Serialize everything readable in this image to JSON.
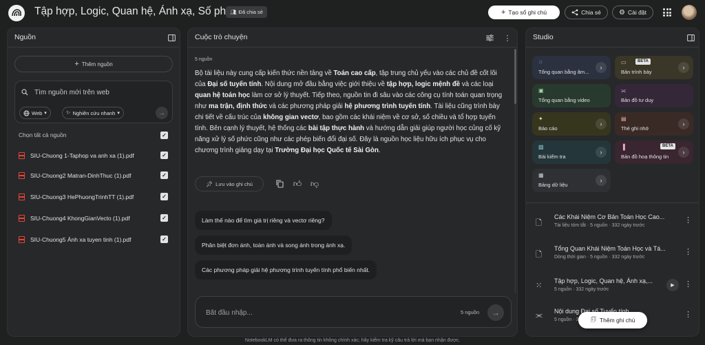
{
  "header": {
    "title": "Tập hợp, Logic, Quan hệ, Ánh xạ, Số phức",
    "shared_badge": "Đã chia sẻ",
    "create_button": "Tạo sổ ghi chú",
    "share_button": "Chia sẻ",
    "settings_button": "Cài đặt"
  },
  "sources": {
    "title": "Nguồn",
    "add_button": "Thêm nguồn",
    "search_placeholder": "Tìm nguồn mới trên web",
    "web_chip": "Web",
    "research_chip": "Nghiên cứu nhanh",
    "select_all": "Chọn tất cả nguồn",
    "items": [
      {
        "label": "SIU-Chuong 1-Taphop va anh xa (1).pdf"
      },
      {
        "label": "SIU-Chuong2 Matran-DinhThuc (1).pdf"
      },
      {
        "label": "SIU-Chuong3 HePhuongTrinhTT (1).pdf"
      },
      {
        "label": "SIU-Chuong4 KhongGianVecto (1).pdf"
      },
      {
        "label": "SIU-Chuong5 Ánh xa tuyen tinh (1).pdf"
      }
    ]
  },
  "chat": {
    "title": "Cuộc trò chuyện",
    "source_count": "5 nguồn",
    "summary": {
      "p1": "Bộ tài liệu này cung cấp kiến thức nền tảng về ",
      "b1": "Toán cao cấp",
      "p2": ", tập trung chủ yếu vào các chủ đề cốt lõi của ",
      "b2": "Đại số tuyến tính",
      "p3": ". Nội dung mở đầu bằng việc giới thiệu về ",
      "b3": "tập hợp, logic mệnh đề",
      "p4": " và các loại ",
      "b4": "quan hệ toán học",
      "p5": " làm cơ sở lý thuyết. Tiếp theo, nguồn tin đi sâu vào các công cụ tính toán quan trọng như ",
      "b5": "ma trận, định thức",
      "p6": " và các phương pháp giải ",
      "b6": "hệ phương trình tuyến tính",
      "p7": ". Tài liệu cũng trình bày chi tiết về cấu trúc của ",
      "b7": "không gian vectơ",
      "p8": ", bao gồm các khái niệm về cơ sở, số chiều và tổ hợp tuyến tính. Bên cạnh lý thuyết, hệ thống các ",
      "b8": "bài tập thực hành",
      "p9": " và hướng dẫn giải giúp người học củng cố kỹ năng xử lý số phức cũng như các phép biến đổi đại số. Đây là nguồn học liệu hữu ích phục vụ cho chương trình giảng dạy tại ",
      "b9": "Trường Đại học Quốc tế Sài Gòn",
      "p10": "."
    },
    "save_note": "Lưu vào ghi chú",
    "suggestions": [
      "Làm thế nào để tìm giá trị riêng và vectơ riêng?",
      "Phân biệt đơn ánh, toàn ánh và song ánh trong ánh xạ.",
      "Các phương pháp giải hệ phương trình tuyến tính phổ biến nhất."
    ],
    "input_placeholder": "Bắt đầu nhập...",
    "input_source_count": "5 nguồn"
  },
  "studio": {
    "title": "Studio",
    "beta_label": "BETA",
    "tiles": [
      {
        "label": "Tổng quan bằng âm..."
      },
      {
        "label": "Bản trình bày"
      },
      {
        "label": "Tổng quan bằng video"
      },
      {
        "label": "Bản đồ tư duy"
      },
      {
        "label": "Báo cáo"
      },
      {
        "label": "Thẻ ghi nhớ"
      },
      {
        "label": "Bài kiểm tra"
      },
      {
        "label": "Bản đồ hoạ thông tin"
      },
      {
        "label": "Bảng dữ liệu"
      }
    ],
    "notes": [
      {
        "title": "Các Khái Niệm Cơ Bản Toán Học Cao...",
        "meta": "Tài liệu tóm tắt · 5 nguồn · 332 ngày trước"
      },
      {
        "title": "Tổng Quan Khái Niệm Toán Học và Tá...",
        "meta": "Dòng thời gian · 5 nguồn · 332 ngày trước"
      },
      {
        "title": "Tập hợp, Logic, Quan hệ, Ánh xạ,...",
        "meta": "5 nguồn · 332 ngày trước"
      },
      {
        "title": "Nội dung Đại số Tuyến tính",
        "meta": "5 nguồn · 332 ngày trước"
      }
    ],
    "add_note": "Thêm ghi chú"
  },
  "footer": "NotebookLM có thể đưa ra thông tin không chính xác; hãy kiểm tra kỹ câu trả lời mà bạn nhận được."
}
